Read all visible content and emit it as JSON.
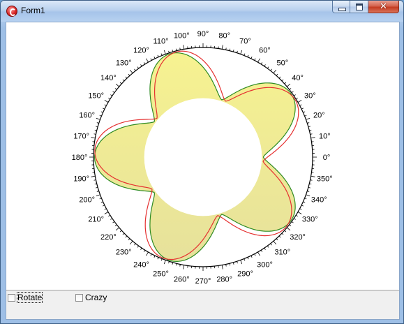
{
  "window": {
    "title": "Form1",
    "min_glyph": "",
    "max_glyph": "",
    "close_glyph": "✕"
  },
  "controls": {
    "rotate_label": "Rotate",
    "crazy_label": "Crazy",
    "rotate_checked": false,
    "crazy_checked": false
  },
  "colors": {
    "fill": "#f5f07d",
    "fill_shaded": "#e2dc8a",
    "green_series": "#2e8b22",
    "red_series": "#e53030",
    "axis": "#000000"
  },
  "chart_data": {
    "type": "polar",
    "angle_labels": [
      "0°",
      "10°",
      "20°",
      "30°",
      "40°",
      "50°",
      "60°",
      "70°",
      "80°",
      "90°",
      "100°",
      "110°",
      "120°",
      "130°",
      "140°",
      "150°",
      "160°",
      "170°",
      "180°",
      "190°",
      "200°",
      "210°",
      "220°",
      "230°",
      "240°",
      "250°",
      "260°",
      "270°",
      "280°",
      "290°",
      "300°",
      "310°",
      "320°",
      "330°",
      "340°",
      "350°"
    ],
    "series": [
      {
        "name": "",
        "color": "#2e8b22",
        "petals": 5,
        "r_inner": 0.55,
        "r_outer": 0.99,
        "phase_deg": 0
      },
      {
        "name": "",
        "color": "#e53030",
        "petals": 5,
        "r_inner": 0.55,
        "r_outer": 0.99,
        "phase_deg": 0
      }
    ],
    "filled_between": true,
    "grid": false
  }
}
